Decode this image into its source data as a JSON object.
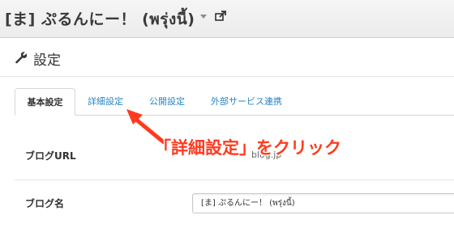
{
  "header": {
    "blog_title": "[ま] ぷるんにー！ (พรุ่งนี้)",
    "title_caret_icon": "chevron-down-icon",
    "share_icon": "external-link-icon"
  },
  "settings": {
    "icon": "wrench-icon",
    "label": "設定"
  },
  "tabs": [
    {
      "label": "基本設定",
      "active": true
    },
    {
      "label": "詳細設定",
      "active": false
    },
    {
      "label": "公開設定",
      "active": false
    },
    {
      "label": "外部サービス連携",
      "active": false
    }
  ],
  "form": {
    "blog_url_label": "ブログURL",
    "blog_url_value": "blog.jp",
    "blog_name_label": "ブログ名",
    "blog_name_value": "[ま] ぷるんにー！ (พรุ่งนี้)"
  },
  "annotation": {
    "text": "「詳細設定」をクリック",
    "color": "#ff3a1f"
  },
  "colors": {
    "link": "#2a86c6",
    "text": "#333333"
  }
}
